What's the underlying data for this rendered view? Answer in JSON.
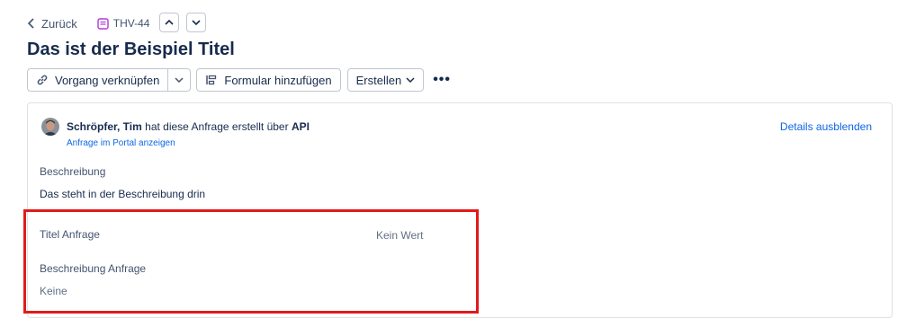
{
  "nav": {
    "back_label": "Zurück",
    "issue_key": "THV-44"
  },
  "header": {
    "title": "Das ist der Beispiel Titel"
  },
  "toolbar": {
    "link_issue_label": "Vorgang verknüpfen",
    "add_form_label": "Formular hinzufügen",
    "create_label": "Erstellen",
    "more_label": "•••"
  },
  "request": {
    "creator_name": "Schröpfer, Tim",
    "created_text": "hat diese Anfrage erstellt über",
    "channel": "API",
    "portal_link": "Anfrage im Portal anzeigen",
    "hide_details": "Details ausblenden"
  },
  "description": {
    "label": "Beschreibung",
    "value": "Das steht in der Beschreibung drin"
  },
  "fields": [
    {
      "label": "Titel Anfrage",
      "value": "Kein Wert"
    },
    {
      "label": "Beschreibung Anfrage",
      "value": "Keine"
    }
  ],
  "colors": {
    "link": "#0c66e4",
    "issue_icon": "#b13ad8",
    "highlight": "#e01b1b"
  }
}
